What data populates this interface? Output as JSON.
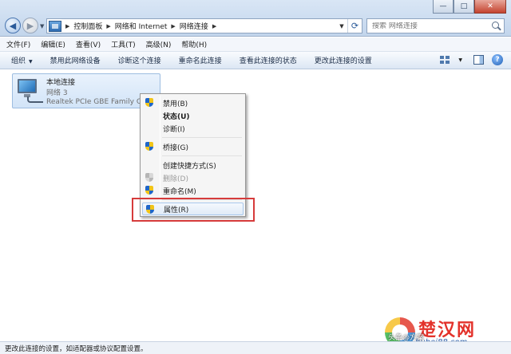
{
  "window": {
    "minimize": "—",
    "maximize": "□",
    "close": "✕"
  },
  "address": {
    "crumbs": [
      "控制面板",
      "网络和 Internet",
      "网络连接"
    ]
  },
  "search": {
    "placeholder": "搜索 网络连接"
  },
  "menubar": {
    "items": [
      "文件(F)",
      "编辑(E)",
      "查看(V)",
      "工具(T)",
      "高级(N)",
      "帮助(H)"
    ]
  },
  "commandbar": {
    "organize": "组织",
    "items": [
      "禁用此网络设备",
      "诊断这个连接",
      "重命名此连接",
      "查看此连接的状态",
      "更改此连接的设置"
    ]
  },
  "connection": {
    "name": "本地连接",
    "network": "网络  3",
    "adapter": "Realtek PCIe GBE Family Controller"
  },
  "context_menu": {
    "items": [
      {
        "label": "禁用(B)",
        "icon": "shield-icon"
      },
      {
        "label": "状态(U)",
        "bold": true
      },
      {
        "label": "诊断(I)"
      },
      {
        "label": "桥接(G)",
        "icon": "shield-icon"
      },
      {
        "label": "创建快捷方式(S)"
      },
      {
        "label": "删除(D)",
        "icon": "shield-icon",
        "disabled": true
      },
      {
        "label": "重命名(M)",
        "icon": "shield-icon"
      },
      {
        "label": "属性(R)",
        "icon": "shield-icon",
        "highlighted": true
      }
    ]
  },
  "colors": {
    "highlight_border": "#d63b3b"
  },
  "watermark": {
    "title": "楚汉网",
    "url": "hubei88.com",
    "overlay": "头条@方案"
  },
  "status": {
    "text": "更改此连接的设置，如适配器或协议配置设置。"
  }
}
